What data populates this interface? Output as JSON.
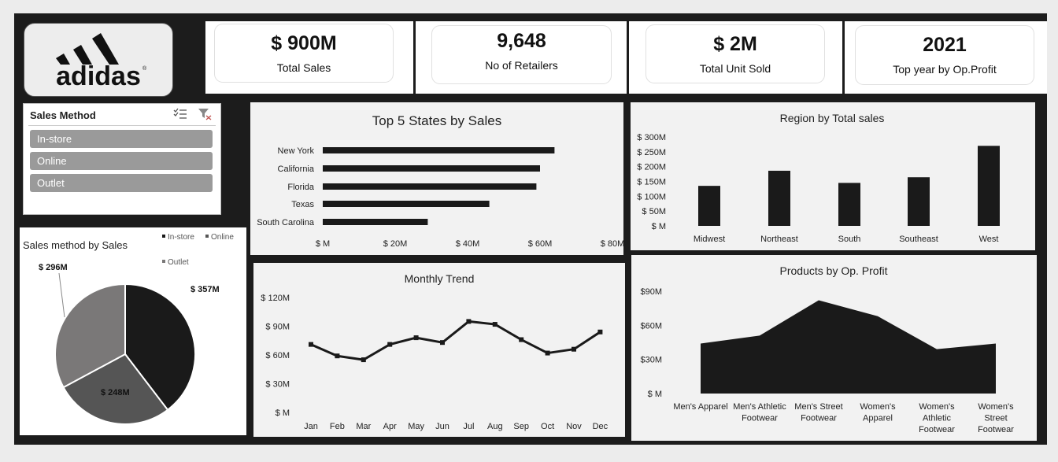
{
  "brand": {
    "name": "adidas"
  },
  "kpis": [
    {
      "value": "$ 900M",
      "label": "Total Sales"
    },
    {
      "value": "9,648",
      "label": "No of Retailers"
    },
    {
      "value": "$ 2M",
      "label": "Total Unit Sold"
    },
    {
      "value": "2021",
      "label": "Top year by Op.Profit"
    }
  ],
  "slicer": {
    "title": "Sales Method",
    "items": [
      "In-store",
      "Online",
      "Outlet"
    ],
    "icons": [
      "multi-select-icon",
      "clear-filter-icon"
    ]
  },
  "colors": {
    "dark": "#1a1a1a",
    "mid": "#555555",
    "light": "#7a7878",
    "panel": "#f2f2f2"
  },
  "chart_data": [
    {
      "id": "pie",
      "type": "pie",
      "title": "Sales method by Sales",
      "categories": [
        "In-store",
        "Online",
        "Outlet"
      ],
      "values": [
        357,
        248,
        296
      ],
      "labels": [
        "$ 357M",
        "$ 248M",
        "$ 296M"
      ],
      "colors": [
        "#1a1a1a",
        "#555555",
        "#7a7878"
      ],
      "legend": "top-right"
    },
    {
      "id": "states",
      "type": "bar",
      "orientation": "horizontal",
      "title": "Top 5 States by Sales",
      "categories": [
        "New York",
        "California",
        "Florida",
        "Texas",
        "South Carolina"
      ],
      "values": [
        64,
        60,
        59,
        46,
        29
      ],
      "xlim": [
        0,
        80
      ],
      "ticks": [
        0,
        20,
        40,
        60,
        80
      ],
      "tick_labels": [
        "$ M",
        "$ 20M",
        "$ 40M",
        "$ 60M",
        "$ 80M"
      ]
    },
    {
      "id": "region",
      "type": "bar",
      "title": "Region by Total sales",
      "categories": [
        "Midwest",
        "Northeast",
        "South",
        "Southeast",
        "West"
      ],
      "values": [
        135,
        186,
        145,
        164,
        270
      ],
      "ylim": [
        0,
        300
      ],
      "ticks": [
        0,
        50,
        100,
        150,
        200,
        250,
        300
      ],
      "tick_labels": [
        "$ M",
        "$ 50M",
        "$ 100M",
        "$ 150M",
        "$ 200M",
        "$ 250M",
        "$ 300M"
      ]
    },
    {
      "id": "monthly",
      "type": "line",
      "title": "Monthly Trend",
      "categories": [
        "Jan",
        "Feb",
        "Mar",
        "Apr",
        "May",
        "Jun",
        "Jul",
        "Aug",
        "Sep",
        "Oct",
        "Nov",
        "Dec"
      ],
      "values": [
        71,
        59,
        55,
        71,
        78,
        73,
        95,
        92,
        76,
        62,
        66,
        84
      ],
      "ylim": [
        0,
        120
      ],
      "ticks": [
        0,
        30,
        60,
        90,
        120
      ],
      "tick_labels": [
        "$ M",
        "$ 30M",
        "$ 60M",
        "$ 90M",
        "$ 120M"
      ]
    },
    {
      "id": "products",
      "type": "area",
      "title": "Products by Op. Profit",
      "categories": [
        "Men's Apparel",
        "Men's Athletic Footwear",
        "Men's Street Footwear",
        "Women's Apparel",
        "Women's Athletic Footwear",
        "Women's Street Footwear"
      ],
      "category_lines": [
        [
          "Men's Apparel"
        ],
        [
          "Men's Athletic",
          "Footwear"
        ],
        [
          "Men's Street",
          "Footwear"
        ],
        [
          "Women's",
          "Apparel"
        ],
        [
          "Women's",
          "Athletic",
          "Footwear"
        ],
        [
          "Women's",
          "Street",
          "Footwear"
        ]
      ],
      "values": [
        44,
        51,
        82,
        68,
        39,
        44
      ],
      "ylim": [
        0,
        90
      ],
      "ticks": [
        0,
        30,
        60,
        90
      ],
      "tick_labels": [
        "$ M",
        "$30M",
        "$60M",
        "$90M"
      ]
    }
  ]
}
